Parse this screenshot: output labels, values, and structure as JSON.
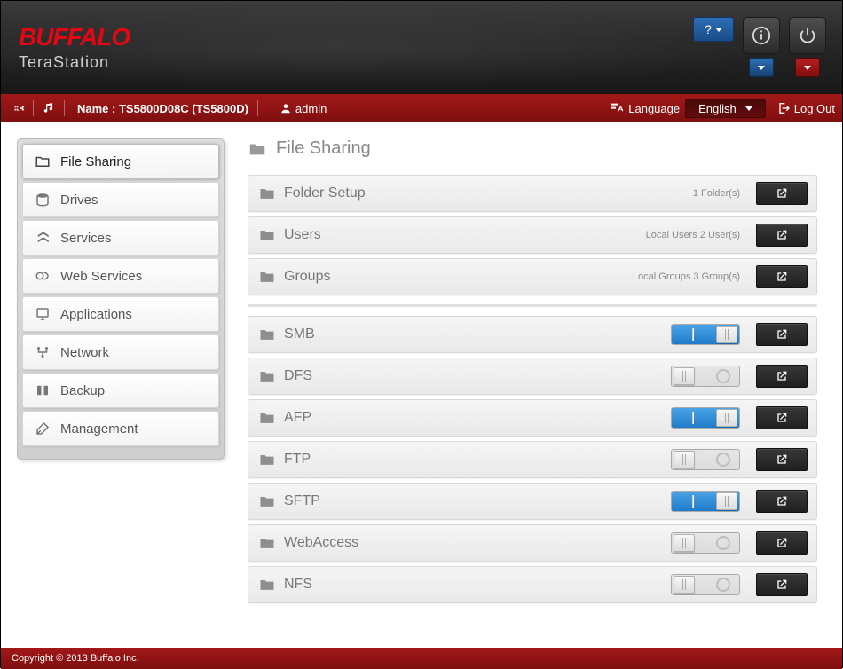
{
  "brand": "BUFFALO",
  "subbrand": "TeraStation",
  "help_label": "?",
  "redbar": {
    "name_label": "Name : TS5800D08C (TS5800D)",
    "user": "admin",
    "language_label": "Language",
    "language_value": "English",
    "logout_label": "Log Out"
  },
  "sidebar": {
    "items": [
      {
        "label": "File Sharing"
      },
      {
        "label": "Drives"
      },
      {
        "label": "Services"
      },
      {
        "label": "Web Services"
      },
      {
        "label": "Applications"
      },
      {
        "label": "Network"
      },
      {
        "label": "Backup"
      },
      {
        "label": "Management"
      }
    ]
  },
  "main": {
    "title": "File Sharing",
    "section1": [
      {
        "label": "Folder Setup",
        "meta": "1 Folder(s)"
      },
      {
        "label": "Users",
        "meta": "Local Users 2 User(s)"
      },
      {
        "label": "Groups",
        "meta": "Local Groups 3 Group(s)"
      }
    ],
    "section2": [
      {
        "label": "SMB",
        "on": true
      },
      {
        "label": "DFS",
        "on": false
      },
      {
        "label": "AFP",
        "on": true
      },
      {
        "label": "FTP",
        "on": false
      },
      {
        "label": "SFTP",
        "on": true
      },
      {
        "label": "WebAccess",
        "on": false
      },
      {
        "label": "NFS",
        "on": false
      }
    ]
  },
  "footer": "Copyright © 2013 Buffalo Inc."
}
